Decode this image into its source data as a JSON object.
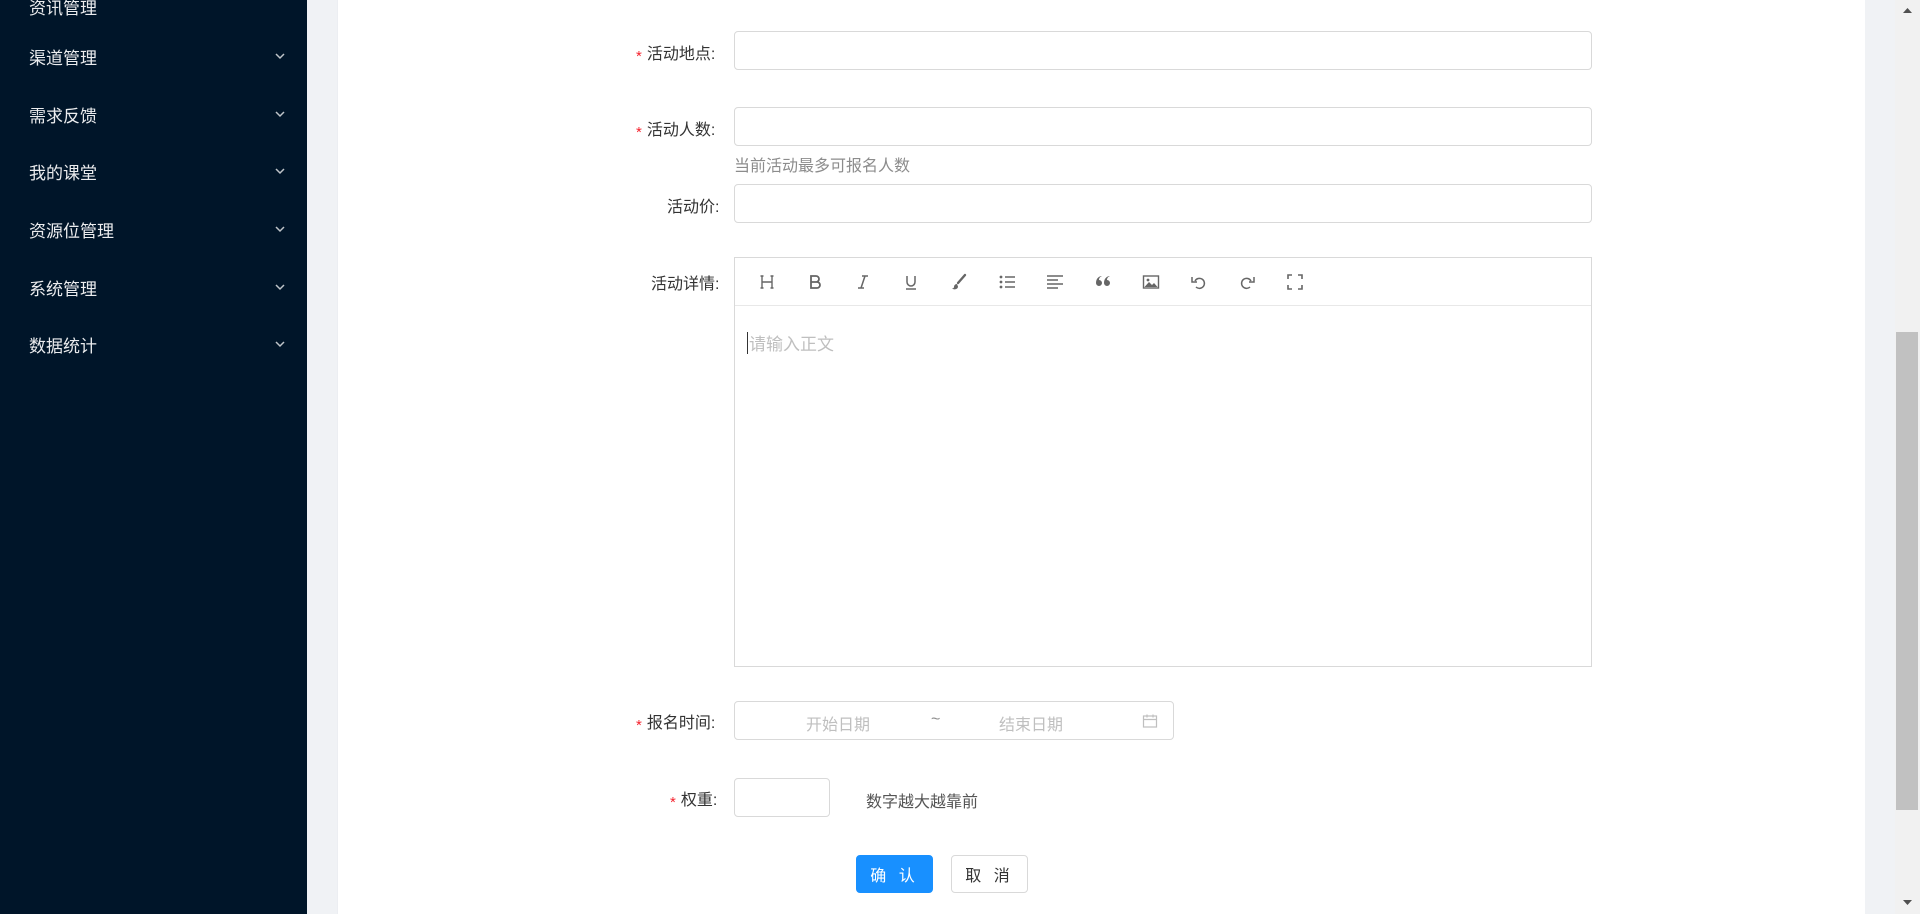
{
  "sidebar": {
    "items": [
      {
        "label": "资讯管理"
      },
      {
        "label": "渠道管理"
      },
      {
        "label": "需求反馈"
      },
      {
        "label": "我的课堂"
      },
      {
        "label": "资源位管理"
      },
      {
        "label": "系统管理"
      },
      {
        "label": "数据统计"
      }
    ]
  },
  "form": {
    "location": {
      "label": "活动地点:",
      "required": "*",
      "value": ""
    },
    "count": {
      "label": "活动人数:",
      "required": "*",
      "value": "",
      "hint": "当前活动最多可报名人数"
    },
    "price": {
      "label": "活动价:",
      "value": ""
    },
    "detail": {
      "label": "活动详情:",
      "placeholder": "请输入正文",
      "tools": [
        "heading-icon",
        "bold-icon",
        "italic-icon",
        "underline-icon",
        "brush-icon",
        "list-icon",
        "align-icon",
        "quote-icon",
        "image-icon",
        "undo-icon",
        "redo-icon",
        "fullscreen-icon"
      ]
    },
    "signup_time": {
      "label": "报名时间:",
      "required": "*",
      "start_placeholder": "开始日期",
      "separator": "~",
      "end_placeholder": "结束日期"
    },
    "weight": {
      "label": "权重:",
      "required": "*",
      "value": "",
      "hint": "数字越大越靠前"
    }
  },
  "actions": {
    "confirm": "确 认",
    "cancel": "取 消"
  },
  "colors": {
    "sidebar_bg": "#001529",
    "primary": "#1890ff",
    "required": "#f5222d"
  }
}
